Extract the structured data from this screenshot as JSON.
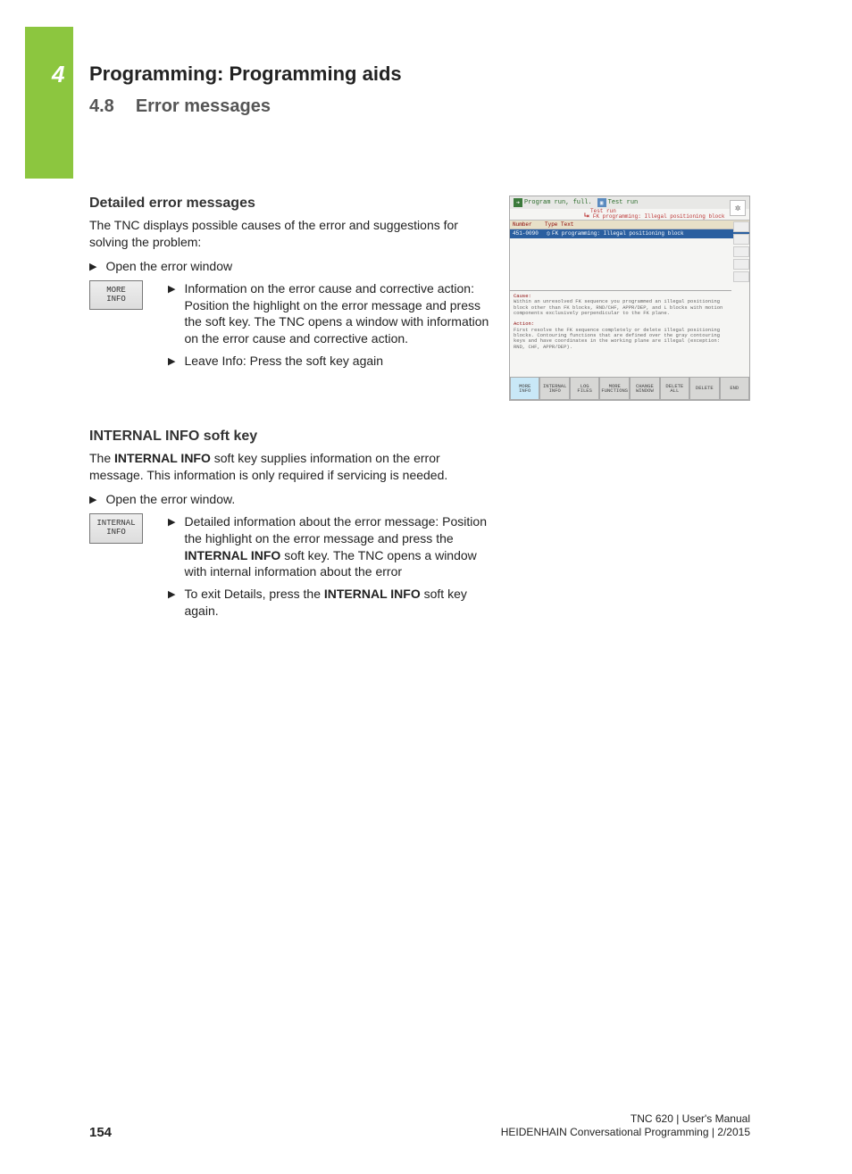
{
  "chapter_tab": "4",
  "chapter_title": "Programming: Programming aids",
  "section_number": "4.8",
  "section_name": "Error messages",
  "block1": {
    "heading": "Detailed error messages",
    "intro": "The TNC displays possible causes of the error and suggestions for solving the problem:",
    "step1": "Open the error window",
    "softkey": "MORE\nINFO",
    "nest1": "Information on the error cause and corrective action: Position the highlight on the error message and press the  soft key. The TNC opens a window with information on the error cause and corrective action.",
    "nest2": "Leave Info: Press the  soft key again"
  },
  "block2": {
    "heading_strong": "INTERNAL INFO",
    "heading_rest": " soft key",
    "intro_a": "The ",
    "intro_strong": "INTERNAL INFO",
    "intro_b": " soft key supplies information on the error message. This information is only required if servicing is needed.",
    "step1": "Open the error window.",
    "softkey": "INTERNAL\nINFO",
    "nest1_a": "Detailed information about the error message: Position the highlight on the error message and press the ",
    "nest1_strong": "INTERNAL INFO",
    "nest1_b": " soft key. The TNC opens a window with internal information about the error",
    "nest2_a": "To exit Details, press the ",
    "nest2_strong": "INTERNAL INFO",
    "nest2_b": " soft key again."
  },
  "screenshot": {
    "mode": "Program run, full.",
    "mode2": "Test run",
    "subhead": "Test run",
    "error_line": "FK programming: Illegal positioning block",
    "th_number": "Number",
    "th_type": "Type Text",
    "row_num": "451-0090",
    "row_text": "FK programming: Illegal positioning block",
    "cause_lbl": "Cause:",
    "cause_txt": "Within an unresolved FK sequence you programmed an illegal positioning block other than FK blocks, RND/CHF, APPR/DEP, and L blocks with motion components exclusively perpendicular to the FK plane.",
    "action_lbl": "Action:",
    "action_txt": "First resolve the FK sequence completely or delete illegal positioning blocks. Contouring functions that are defined over the gray contouring keys and have coordinates in the working plane are illegal (exception: RND, CHF, APPR/DEP).",
    "sk": [
      "MORE\nINFO",
      "INTERNAL\nINFO",
      "LOG\nFILES",
      "MORE\nFUNCTIONS",
      "CHANGE\nWINDOW",
      "DELETE\nALL",
      "DELETE",
      "END"
    ]
  },
  "footer": {
    "page": "154",
    "line1": "TNC 620 | User's Manual",
    "line2": "HEIDENHAIN Conversational Programming | 2/2015"
  }
}
